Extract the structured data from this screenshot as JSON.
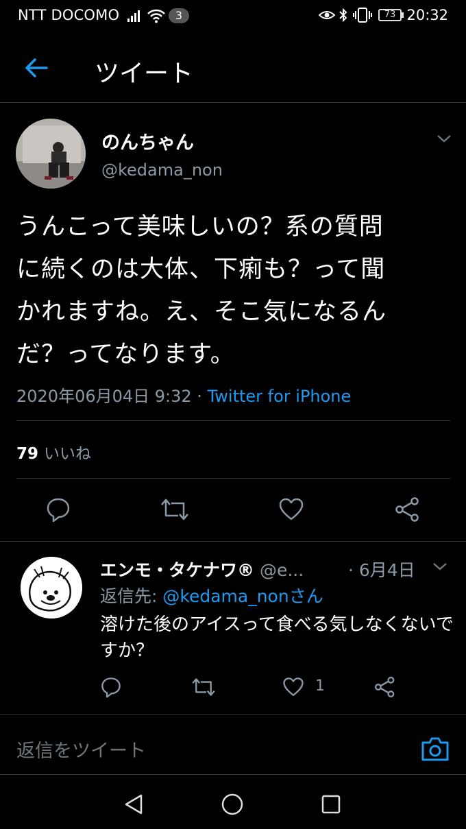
{
  "status_bar": {
    "carrier": "NTT DOCOMO",
    "notification_count": "3",
    "battery": "73",
    "time": "20:32"
  },
  "header": {
    "title": "ツイート"
  },
  "tweet": {
    "author_name": "のんちゃん",
    "author_handle": "@kedama_non",
    "text_lines": [
      "うんこって美味しいの？系の質問",
      "に続くのは大体、下痢も？って聞",
      "かれますね。え、そこ気になるん",
      "だ？ってなります。"
    ],
    "timestamp": "2020年06月04日 9:32 · ",
    "source": "Twitter for iPhone",
    "likes_count": "79",
    "likes_label": "いいね"
  },
  "reply": {
    "author_name": "エンモ・タケナワ®",
    "author_handle": " @e...",
    "date": "· 6月4日",
    "reply_to_label": "返信先: ",
    "reply_to_user": "@kedama_nonさん",
    "text": "溶けた後のアイスって食べる気しなくないですか？",
    "like_count": "1"
  },
  "compose": {
    "placeholder": "返信をツイート"
  },
  "colors": {
    "background": "#000000",
    "accent": "#1d9bf0",
    "muted": "#8b98a5",
    "divider": "#2f3336"
  }
}
